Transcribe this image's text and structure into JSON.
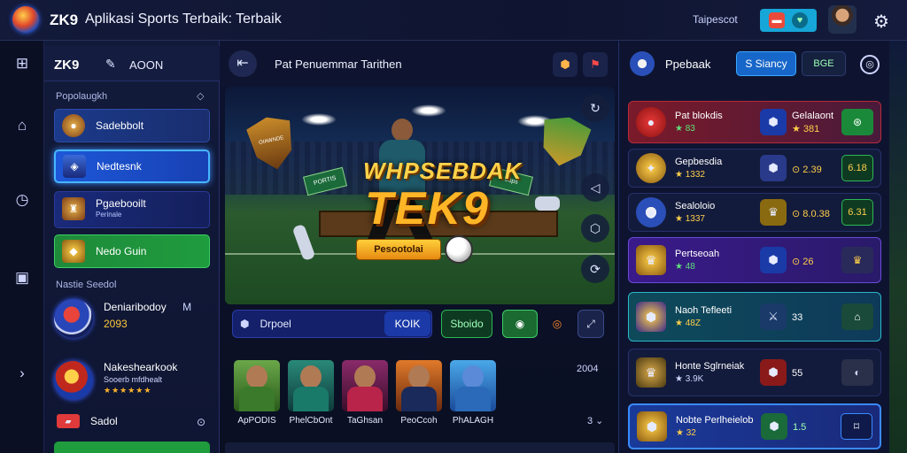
{
  "app": {
    "brand": "ZK9",
    "title": "Aplikasi Sports Terbaik: Terbaik",
    "user_label": "Taipescot"
  },
  "rail": {
    "icons": [
      "plus-square-icon",
      "house-icon",
      "clock-icon",
      "chart-icon",
      "chevron-right-icon"
    ]
  },
  "sidebar": {
    "brand": "ZK9",
    "addon": "AOON",
    "section1": "Popolaugkh",
    "items": [
      {
        "label": "Sadebbolt"
      },
      {
        "label": "Nedtesnk"
      },
      {
        "label": "Pgaebooilt",
        "sub": "Perinale"
      },
      {
        "label": "Nedo Guin"
      }
    ],
    "section2": "Nastie Seedol",
    "teams": [
      {
        "name": "Deniaribodoy",
        "badge": "M",
        "value": "2093"
      },
      {
        "name": "Nakeshearkook",
        "sub": "Sooerb mfdhealt",
        "stars": "★★★★★★"
      }
    ],
    "event": {
      "label": "Sadol"
    }
  },
  "main": {
    "header_title": "Pat Penuemmar Tarithen",
    "hero": {
      "line1": "WHPSEBDAK",
      "line2": "TEK9",
      "button": "Pesootolai",
      "badge_l": "OIAWNDE",
      "sign_l": "PORTIS",
      "sign_r": "Ssps"
    },
    "row": {
      "label": "Drpoel",
      "btn1": "KOIK",
      "btn2": "Sboido"
    },
    "players_header": "2004",
    "players": [
      {
        "name": "ApPODIS",
        "color": "#3a7a2a"
      },
      {
        "name": "PhelCbOnt",
        "color": "#1a7a6a"
      },
      {
        "name": "TaGhsan",
        "color": "#7a1a4a"
      },
      {
        "name": "PeoCcoh",
        "color": "#1a3a7a"
      },
      {
        "name": "PhALAGH",
        "color": "#2a6ab8"
      }
    ],
    "more_count": "3"
  },
  "right": {
    "title": "Ppebaak",
    "tab": "S Siancy",
    "tab2": "BGE",
    "matches": [
      {
        "name": "Pat blokdis",
        "odd": "★ 83",
        "rtop": "Gelalaont",
        "rval": "★ 381"
      },
      {
        "name": "Gepbesdia",
        "odd": "★ 1332",
        "rtop": "",
        "rval": "⊙ 2.39",
        "extra": "6.18"
      },
      {
        "name": "Sealoloio",
        "odd": "★ 1337",
        "rtop": "",
        "rval": "⊙ 8.0.38",
        "extra": "6.31"
      },
      {
        "name": "Pertseoah",
        "odd": "★ 48",
        "rtop": "",
        "rval": "⊙ 26"
      },
      {
        "name": "Naoh Tefleeti",
        "odd": "★ 48Z",
        "rtop": "",
        "rval": "33"
      },
      {
        "name": "Honte Sglrneiak",
        "odd": "★ 3.9K",
        "rtop": "",
        "rval": "55"
      },
      {
        "name": "Nobte Perlheielob",
        "odd": "★ 32",
        "rtop": "",
        "rval": "1.5"
      }
    ]
  }
}
